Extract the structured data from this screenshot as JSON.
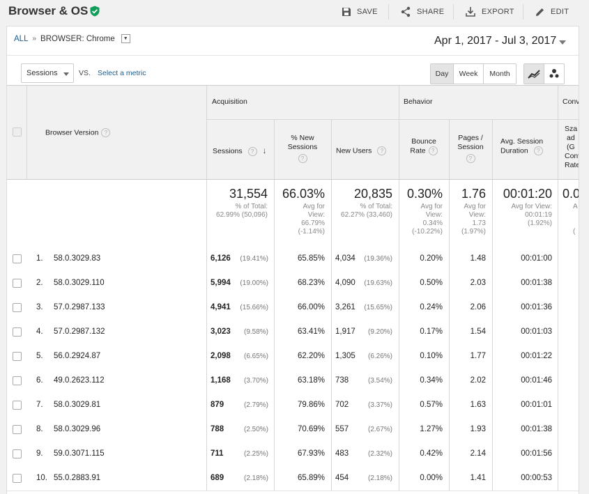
{
  "header": {
    "title": "Browser & OS",
    "actions": {
      "save": "SAVE",
      "share": "SHARE",
      "export": "EXPORT",
      "edit": "EDIT"
    }
  },
  "breadcrumb": {
    "all": "ALL",
    "separator": "»",
    "filter": "BROWSER: Chrome"
  },
  "date_range": "Apr 1, 2017 - Jul 3, 2017",
  "controls": {
    "primary_metric": "Sessions",
    "vs": "VS.",
    "select_metric": "Select a metric",
    "periods": [
      "Day",
      "Week",
      "Month"
    ],
    "active_period": "Day"
  },
  "table": {
    "dimension_header": "Browser Version",
    "groups": {
      "acquisition": "Acquisition",
      "behavior": "Behavior",
      "conversions": "Conv"
    },
    "columns": {
      "sessions": "Sessions",
      "new_sessions_1": "% New",
      "new_sessions_2": "Sessions",
      "new_users": "New Users",
      "bounce_1": "Bounce",
      "bounce_2": "Rate",
      "pages_1": "Pages /",
      "pages_2": "Session",
      "duration_1": "Avg. Session",
      "duration_2": "Duration",
      "conv_1": "Sza",
      "conv_2": "ad",
      "conv_3": "(G",
      "conv_4": "Conv",
      "conv_5": "Rate"
    },
    "totals": {
      "sessions": "31,554",
      "sessions_sub1": "% of Total:",
      "sessions_sub2": "62.99% (50,096)",
      "new_sessions": "66.03%",
      "new_sessions_sub1": "Avg for",
      "new_sessions_sub2": "View:",
      "new_sessions_sub3": "66.79%",
      "new_sessions_sub4": "(-1.14%)",
      "new_users": "20,835",
      "new_users_sub1": "% of Total:",
      "new_users_sub2": "62.27% (33,460)",
      "bounce": "0.30%",
      "bounce_sub1": "Avg for",
      "bounce_sub2": "View:",
      "bounce_sub3": "0.34%",
      "bounce_sub4": "(-10.22%)",
      "pages": "1.76",
      "pages_sub1": "Avg for",
      "pages_sub2": "View:",
      "pages_sub3": "1.73",
      "pages_sub4": "(1.97%)",
      "duration": "00:01:20",
      "duration_sub1": "Avg for View:",
      "duration_sub2": "00:01:19",
      "duration_sub3": "(1.92%)",
      "conv": "0.0",
      "conv_sub1": "A",
      "conv_sub2": "("
    },
    "rows": [
      {
        "n": "1.",
        "version": "58.0.3029.83",
        "sessions": "6,126",
        "sessions_pct": "(19.41%)",
        "new_sessions": "65.85%",
        "new_users": "4,034",
        "new_users_pct": "(19.36%)",
        "bounce": "0.20%",
        "pages": "1.48",
        "duration": "00:01:00"
      },
      {
        "n": "2.",
        "version": "58.0.3029.110",
        "sessions": "5,994",
        "sessions_pct": "(19.00%)",
        "new_sessions": "68.23%",
        "new_users": "4,090",
        "new_users_pct": "(19.63%)",
        "bounce": "0.50%",
        "pages": "2.03",
        "duration": "00:01:38"
      },
      {
        "n": "3.",
        "version": "57.0.2987.133",
        "sessions": "4,941",
        "sessions_pct": "(15.66%)",
        "new_sessions": "66.00%",
        "new_users": "3,261",
        "new_users_pct": "(15.65%)",
        "bounce": "0.24%",
        "pages": "2.06",
        "duration": "00:01:36"
      },
      {
        "n": "4.",
        "version": "57.0.2987.132",
        "sessions": "3,023",
        "sessions_pct": "(9.58%)",
        "new_sessions": "63.41%",
        "new_users": "1,917",
        "new_users_pct": "(9.20%)",
        "bounce": "0.17%",
        "pages": "1.54",
        "duration": "00:01:03"
      },
      {
        "n": "5.",
        "version": "56.0.2924.87",
        "sessions": "2,098",
        "sessions_pct": "(6.65%)",
        "new_sessions": "62.20%",
        "new_users": "1,305",
        "new_users_pct": "(6.26%)",
        "bounce": "0.10%",
        "pages": "1.77",
        "duration": "00:01:22"
      },
      {
        "n": "6.",
        "version": "49.0.2623.112",
        "sessions": "1,168",
        "sessions_pct": "(3.70%)",
        "new_sessions": "63.18%",
        "new_users": "738",
        "new_users_pct": "(3.54%)",
        "bounce": "0.34%",
        "pages": "2.02",
        "duration": "00:01:46"
      },
      {
        "n": "7.",
        "version": "58.0.3029.81",
        "sessions": "879",
        "sessions_pct": "(2.79%)",
        "new_sessions": "79.86%",
        "new_users": "702",
        "new_users_pct": "(3.37%)",
        "bounce": "0.57%",
        "pages": "1.63",
        "duration": "00:01:01"
      },
      {
        "n": "8.",
        "version": "58.0.3029.96",
        "sessions": "788",
        "sessions_pct": "(2.50%)",
        "new_sessions": "70.69%",
        "new_users": "557",
        "new_users_pct": "(2.67%)",
        "bounce": "1.27%",
        "pages": "1.93",
        "duration": "00:01:38"
      },
      {
        "n": "9.",
        "version": "59.0.3071.115",
        "sessions": "711",
        "sessions_pct": "(2.25%)",
        "new_sessions": "67.93%",
        "new_users": "483",
        "new_users_pct": "(2.32%)",
        "bounce": "0.42%",
        "pages": "2.14",
        "duration": "00:01:56"
      },
      {
        "n": "10.",
        "version": "55.0.2883.91",
        "sessions": "689",
        "sessions_pct": "(2.18%)",
        "new_sessions": "65.89%",
        "new_users": "454",
        "new_users_pct": "(2.18%)",
        "bounce": "0.00%",
        "pages": "1.41",
        "duration": "00:00:53"
      }
    ]
  },
  "colors": {
    "link": "#1a5d8f",
    "verified": "#0f9d58",
    "header_bg": "#f1f1f1"
  }
}
